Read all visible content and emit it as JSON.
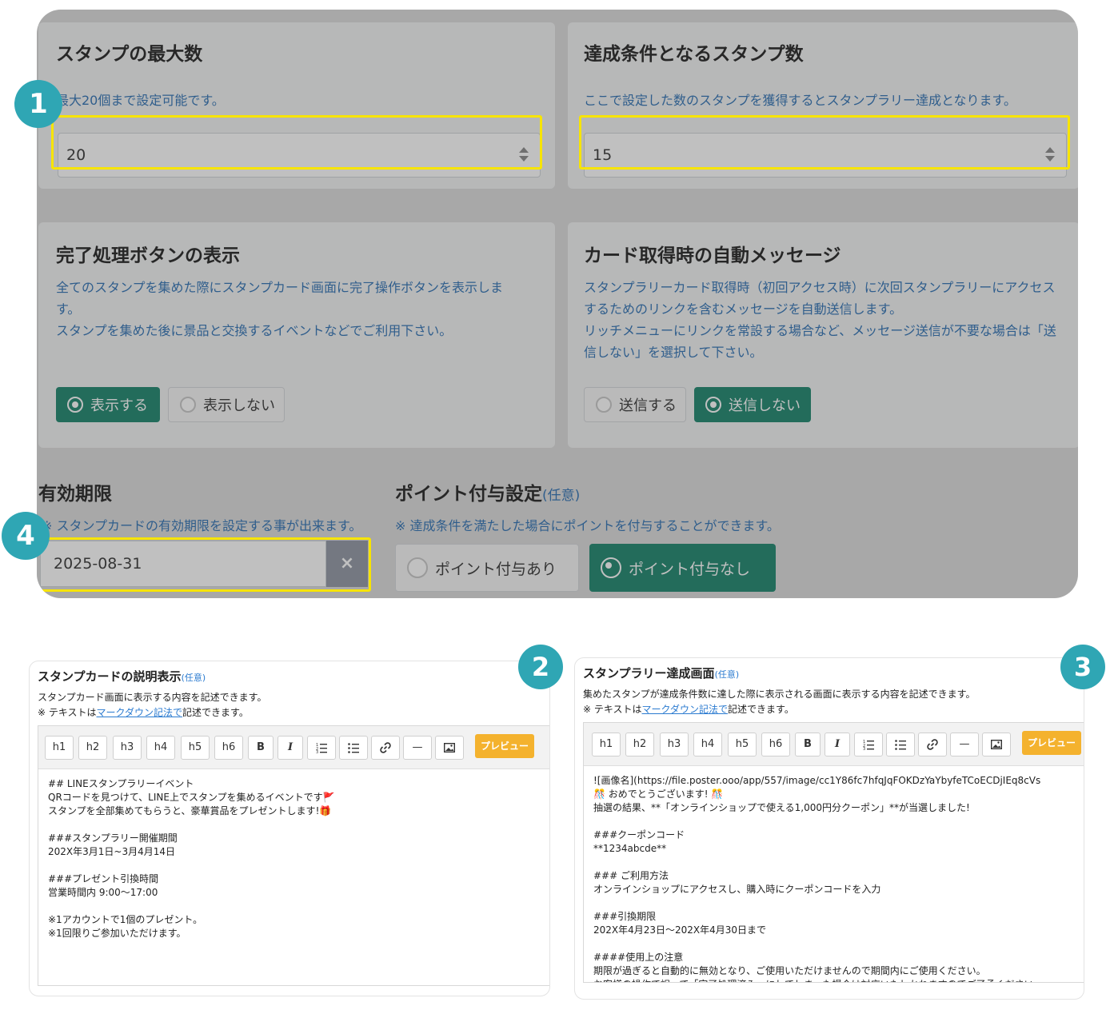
{
  "settings": {
    "max_stamps": {
      "title": "スタンプの最大数",
      "desc": "最大20個まで設定可能です。",
      "value": "20",
      "badge": "1"
    },
    "goal_stamps": {
      "title": "達成条件となるスタンプ数",
      "desc": "ここで設定した数のスタンプを獲得するとスタンプラリー達成となります。",
      "value": "15"
    },
    "complete_button": {
      "title": "完了処理ボタンの表示",
      "desc_line1": "全てのスタンプを集めた際にスタンプカード画面に完了操作ボタンを表示しま",
      "desc_line2": "す。",
      "desc_line3": "スタンプを集めた後に景品と交換するイベントなどでご利用下さい。",
      "option_show": "表示する",
      "option_hide": "表示しない",
      "selected": "表示する"
    },
    "auto_message": {
      "title": "カード取得時の自動メッセージ",
      "desc_line1": "スタンプラリーカード取得時（初回アクセス時）に次回スタンプラリーにアクセス",
      "desc_line2": "するためのリンクを含むメッセージを自動送信します。",
      "desc_line3": "リッチメニューにリンクを常設する場合など、メッセージ送信が不要な場合は「送",
      "desc_line4": "信しない」を選択して下さい。",
      "option_send": "送信する",
      "option_nosend": "送信しない",
      "selected": "送信しない"
    },
    "expiry": {
      "title": "有効期限",
      "desc": "※ スタンプカードの有効期限を設定する事が出来ます。",
      "value": "2025-08-31",
      "clear": "×",
      "badge": "4"
    },
    "points": {
      "title": "ポイント付与設定",
      "optional": "(任意)",
      "desc": "※ 達成条件を満たした場合にポイントを付与することができます。",
      "option_yes": "ポイント付与あり",
      "option_no": "ポイント付与なし",
      "selected": "ポイント付与なし"
    }
  },
  "toolbar_buttons": [
    "h1",
    "h2",
    "h3",
    "h4",
    "h5",
    "h6",
    "B",
    "I",
    "list-ordered-icon",
    "list-bullet-icon",
    "link-icon",
    "—",
    "image-icon"
  ],
  "editor_card": {
    "badge": "2",
    "title": "スタンプカードの説明表示",
    "optional": "(任意)",
    "desc1": "スタンプカード画面に表示する内容を記述できます。",
    "desc2_prefix": "※ テキストは",
    "desc2_link": "マークダウン記法で",
    "desc2_suffix": "記述できます。",
    "preview": "プレビュー",
    "content": "## LINEスタンプラリーイベント\nQRコードを見つけて、LINE上でスタンプを集めるイベントです🚩\nスタンプを全部集めてもらうと、豪華賞品をプレゼントします!🎁\n\n###スタンプラリー開催期間\n202X年3月1日~3月4月14日\n\n###プレゼント引換時間\n営業時間内 9:00〜17:00\n\n※1アカウントで1個のプレゼント。\n※1回限りご参加いただけます。"
  },
  "editor_complete": {
    "badge": "3",
    "title": "スタンプラリー達成画面",
    "optional": "(任意)",
    "desc1": "集めたスタンプが達成条件数に達した際に表示される画面に表示する内容を記述できます。",
    "desc2_prefix": "※ テキストは",
    "desc2_link": "マークダウン記法で",
    "desc2_suffix": "記述できます。",
    "preview": "プレビュー",
    "content": "![画像名](https://file.poster.ooo/app/557/image/cc1Y86fc7hfqJqFOKDzYaYbyfeTCoECDjIEq8cVs\n🎊 おめでとうございます! 🎊\n抽選の結果、**「オンラインショップで使える1,000円分クーポン」**が当選しました!\n\n###クーポンコード\n**1234abcde**\n\n### ご利用方法\nオンラインショップにアクセスし、購入時にクーポンコードを入力\n\n###引換期限\n202X年4月23日〜202X年4月30日まで\n\n####使用上の注意\n期限が過ぎると自動的に無効となり、ご使用いただけませんので期間内にご使用ください。\nお客様の操作で誤って「完了処理済み」にしてしまった場合は対応いたしかねますのでご了承ください。"
  }
}
